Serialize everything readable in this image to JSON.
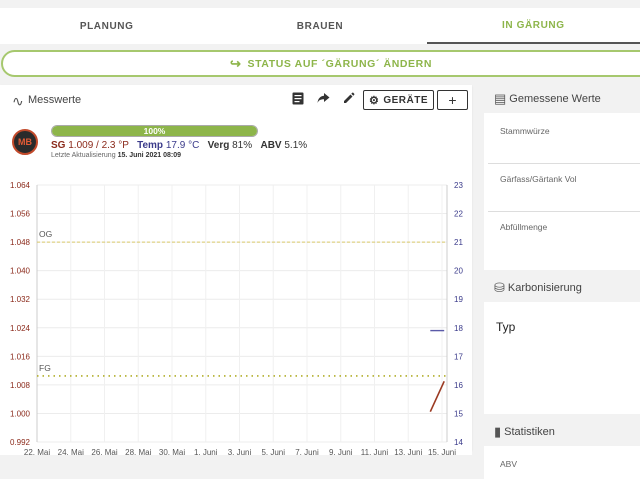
{
  "tabs": [
    {
      "label": "PLANUNG"
    },
    {
      "label": "BRAUEN"
    },
    {
      "label": "IN GÄRUNG"
    }
  ],
  "status_button": {
    "label": "STATUS AUF ´GÄRUNG´ ÄNDERN",
    "icon": "redo-arrow-icon"
  },
  "measurements": {
    "title": "Messwerte",
    "devices_button": "GERÄTE",
    "add_button": "+",
    "progress": {
      "label": "100%",
      "value": 100
    },
    "logo_text": "MB",
    "sg_label": "SG",
    "sg_value": "1.009 / 2.3 °P",
    "temp_label": "Temp",
    "temp_value": "17.9 °C",
    "verg_label": "Verg",
    "verg_value": "81%",
    "abv_label": "ABV",
    "abv_value": "5.1%",
    "updated_label": "Letzte Aktualisierung",
    "updated_value": "15. Juni 2021 08:09"
  },
  "right": {
    "measured": {
      "title": "Gemessene Werte",
      "fields": [
        "Stammwürze",
        "Gärfass/Gärtank Vol",
        "Abfüllmenge"
      ]
    },
    "carbonation": {
      "title": "Karbonisierung",
      "type_label": "Typ"
    },
    "stats": {
      "title": "Statistiken",
      "first_field": "ABV"
    }
  },
  "colors": {
    "accent": "#8db54a",
    "sg": "#8b2a1b",
    "temp": "#3a3a8a",
    "og_line": "#d9c96a"
  },
  "chart_data": {
    "type": "line",
    "x_ticks": [
      "22. Mai",
      "24. Mai",
      "26. Mai",
      "28. Mai",
      "30. Mai",
      "1. Juni",
      "3. Juni",
      "5. Juni",
      "7. Juni",
      "9. Juni",
      "11. Juni",
      "13. Juni",
      "15. Juni"
    ],
    "xlim": [
      "2021-05-22",
      "2021-06-15"
    ],
    "y_left": {
      "ticks": [
        "1.064",
        "1.056",
        "1.048",
        "1.040",
        "1.032",
        "1.024",
        "1.016",
        "1.008",
        "1.000",
        "0.992"
      ],
      "range": [
        0.992,
        1.064
      ]
    },
    "y_right": {
      "ticks": [
        "23",
        "22",
        "21",
        "20",
        "19",
        "18",
        "17",
        "16",
        "15",
        "14"
      ],
      "range": [
        14,
        23
      ]
    },
    "reference_lines": [
      {
        "label": "OG",
        "value": 1.048
      },
      {
        "label": "FG",
        "value": 1.0105
      }
    ],
    "series": [
      {
        "axis": "left",
        "points": [
          [
            "2021-06-14T12:00",
            1.0005
          ],
          [
            "2021-06-15T08:00",
            1.009
          ]
        ]
      },
      {
        "axis": "right",
        "points": [
          [
            "2021-06-14T12:00",
            17.9
          ],
          [
            "2021-06-15T08:00",
            17.9
          ]
        ]
      }
    ],
    "grid": true
  }
}
